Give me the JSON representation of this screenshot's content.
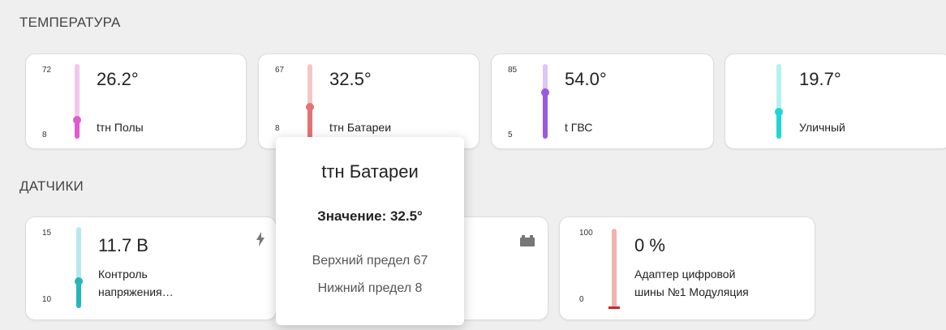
{
  "sections": {
    "temperature": "ТЕМПЕРАТУРА",
    "sensors": "ДАТЧИКИ"
  },
  "temperature_cards": [
    {
      "max": "72",
      "min": "8",
      "value": "26.2°",
      "name": "tтн Полы",
      "color": "#e05bd0",
      "track": "#f2c6ee",
      "level": 0.26
    },
    {
      "max": "67",
      "min": "8",
      "value": "32.5°",
      "name": "tтн Батареи",
      "color": "#e57373",
      "track": "#f5c6c6",
      "level": 0.42
    },
    {
      "max": "85",
      "min": "5",
      "value": "54.0°",
      "name": "t ГВС",
      "color": "#9b59e0",
      "track": "#dcc7f5",
      "level": 0.61
    },
    {
      "max": "",
      "min": "",
      "value": "19.7°",
      "name": "Уличный",
      "color": "#1fd6d6",
      "track": "#b5f1f1",
      "level": 0.38
    }
  ],
  "sensor_cards": [
    {
      "max": "15",
      "min": "10",
      "value": "11.7 В",
      "name_line1": "Контроль",
      "name_line2": "напряжения…",
      "icon": "lightning-icon",
      "color": "#26b5bf",
      "track": "#b6e9ee",
      "level": 0.34
    },
    {
      "icon": "battery-icon"
    },
    {
      "max": "100",
      "min": "0",
      "value": "0 %",
      "name_line1": "Адаптер цифровой",
      "name_line2": "шины №1 Модуляция",
      "color": "#c62828",
      "track": "#f0b2b2",
      "level": 0.0
    }
  ],
  "tooltip": {
    "title": "tтн Батареи",
    "value": "Значение: 32.5°",
    "upper": "Верхний предел 67",
    "lower": "Нижний предел 8"
  }
}
